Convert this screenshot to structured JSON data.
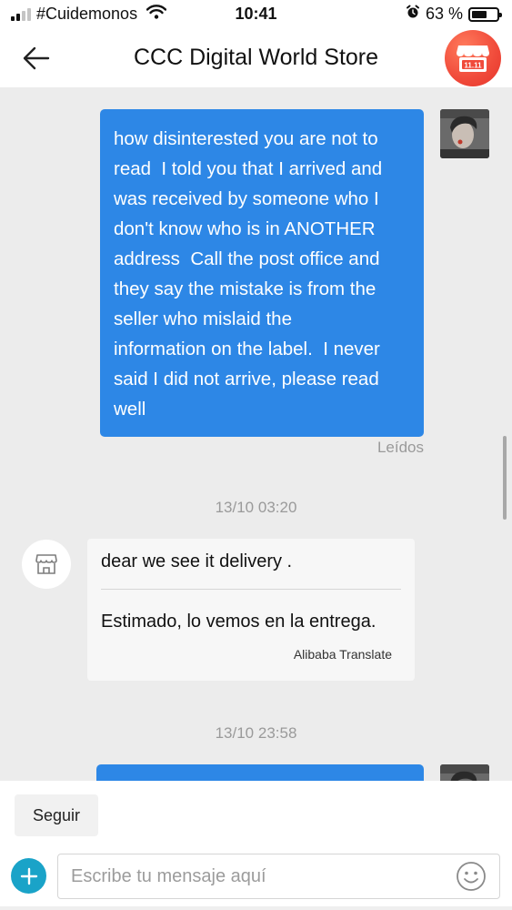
{
  "status_bar": {
    "carrier": "#Cuidemonos",
    "time": "10:41",
    "battery_percent": "63 %",
    "battery_level": 0.63
  },
  "header": {
    "title": "CCC Digital World Store",
    "store_badge_text": "11.11"
  },
  "messages": [
    {
      "direction": "outgoing",
      "text": "how disinterested you are not to\nread  I told you that I arrived and\nwas received by someone who I\ndon't know who is in ANOTHER\naddress  Call the post office and\nthey say the mistake is from the\nseller who mislaid the\ninformation on the label.  I never\nsaid I did not arrive, please read\nwell",
      "status": "Leídos"
    },
    {
      "timestamp": "13/10 03:20"
    },
    {
      "direction": "incoming",
      "original": "dear we see it delivery .",
      "translation": "Estimado, lo vemos en la entrega.",
      "translator": "Alibaba Translate"
    },
    {
      "timestamp": "13/10 23:58"
    }
  ],
  "footer": {
    "follow_label": "Seguir",
    "input_placeholder": "Escribe tu mensaje aquí"
  },
  "colors": {
    "outgoing_bubble": "#2d87e6",
    "plus_button": "#1aa3c8",
    "store_badge": "#f04a3a"
  }
}
